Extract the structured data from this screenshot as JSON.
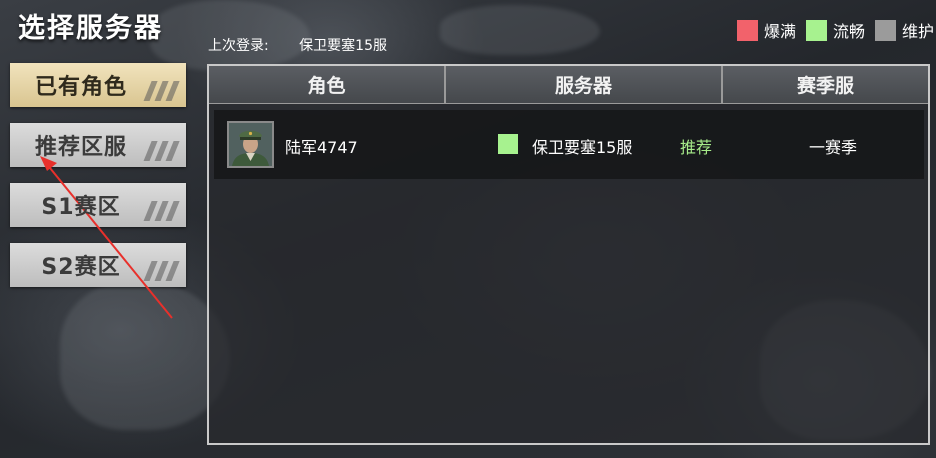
{
  "title": "选择服务器",
  "last_login": {
    "label": "上次登录:",
    "server": "保卫要塞15服"
  },
  "legend": [
    {
      "label": "爆满",
      "color": "#f2626b"
    },
    {
      "label": "流畅",
      "color": "#a7f28f"
    },
    {
      "label": "维护",
      "color": "#9b9b9b"
    }
  ],
  "side_tabs": [
    {
      "label": "已有角色",
      "active": true
    },
    {
      "label": "推荐区服",
      "active": false
    },
    {
      "label": "S1赛区",
      "active": false
    },
    {
      "label": "S2赛区",
      "active": false
    }
  ],
  "table": {
    "headers": {
      "role": "角色",
      "server": "服务器",
      "season": "赛季服"
    },
    "rows": [
      {
        "role_name": "陆军4747",
        "status_color": "#a7f28f",
        "server": "保卫要塞15服",
        "tag": "推荐",
        "season": "一赛季",
        "avatar_icon": "soldier-portrait-icon"
      }
    ]
  },
  "annotation": {
    "color": "#e8302b",
    "icon": "red-arrow-annotation"
  }
}
